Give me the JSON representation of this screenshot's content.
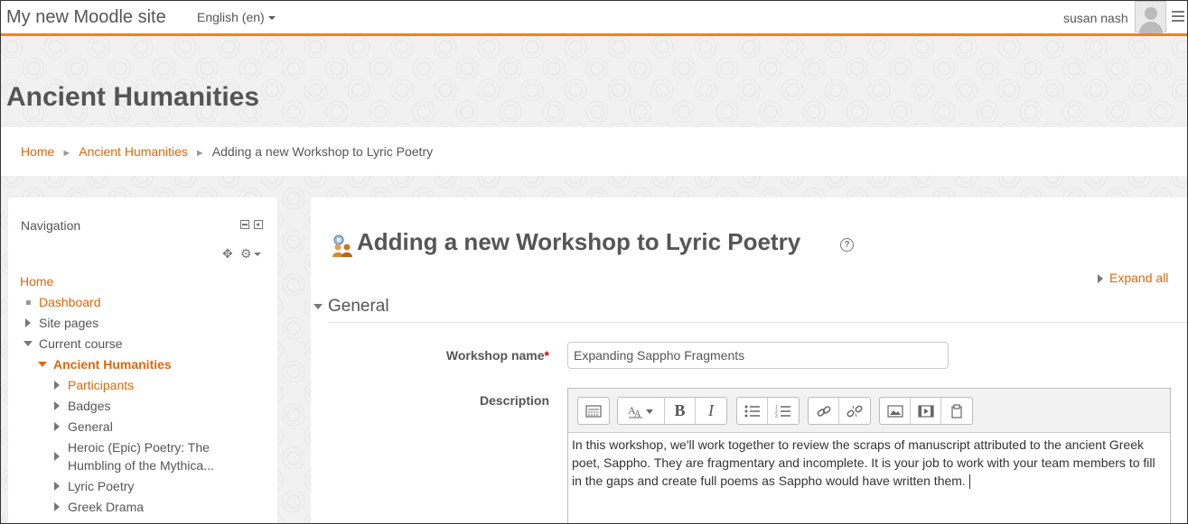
{
  "navbar": {
    "brand": "My new Moodle site",
    "language": "English ‎(en)‎",
    "user_name": "susan nash"
  },
  "header": {
    "course_title": "Ancient Humanities"
  },
  "breadcrumb": {
    "items": [
      "Home",
      "Ancient Humanities",
      "Adding a new Workshop to Lyric Poetry"
    ]
  },
  "navigation": {
    "title": "Navigation",
    "items": [
      {
        "label": "Home"
      },
      {
        "label": "Dashboard"
      },
      {
        "label": "Site pages"
      },
      {
        "label": "Current course"
      },
      {
        "label": "Ancient Humanities"
      },
      {
        "label": "Participants"
      },
      {
        "label": "Badges"
      },
      {
        "label": "General"
      },
      {
        "label": "Heroic (Epic) Poetry: The"
      },
      {
        "label": "Humbling of the Mythica..."
      },
      {
        "label": "Lyric Poetry"
      },
      {
        "label": "Greek Drama"
      }
    ]
  },
  "main": {
    "heading": "Adding a new Workshop to Lyric Poetry",
    "expand_all": "Expand all",
    "section_general": "General",
    "workshop_name_label": "Workshop name",
    "workshop_name_value": "Expanding Sappho Fragments",
    "description_label": "Description",
    "description_text": "In this workshop, we'll work together to review the scraps of manuscript attributed to the ancient Greek poet, Sappho. They are fragmentary and incomplete. It is your job to work with your team members to fill in the gaps and create full poems as Sappho would have written them."
  },
  "colors": {
    "accent": "#f98012",
    "link": "#e1670a",
    "required": "#cc0000"
  },
  "icons": [
    "move-icon",
    "gear-icon",
    "help-icon",
    "workshop-icon",
    "bold-icon",
    "italic-icon",
    "link-icon",
    "unlink-icon",
    "image-icon",
    "media-icon"
  ]
}
